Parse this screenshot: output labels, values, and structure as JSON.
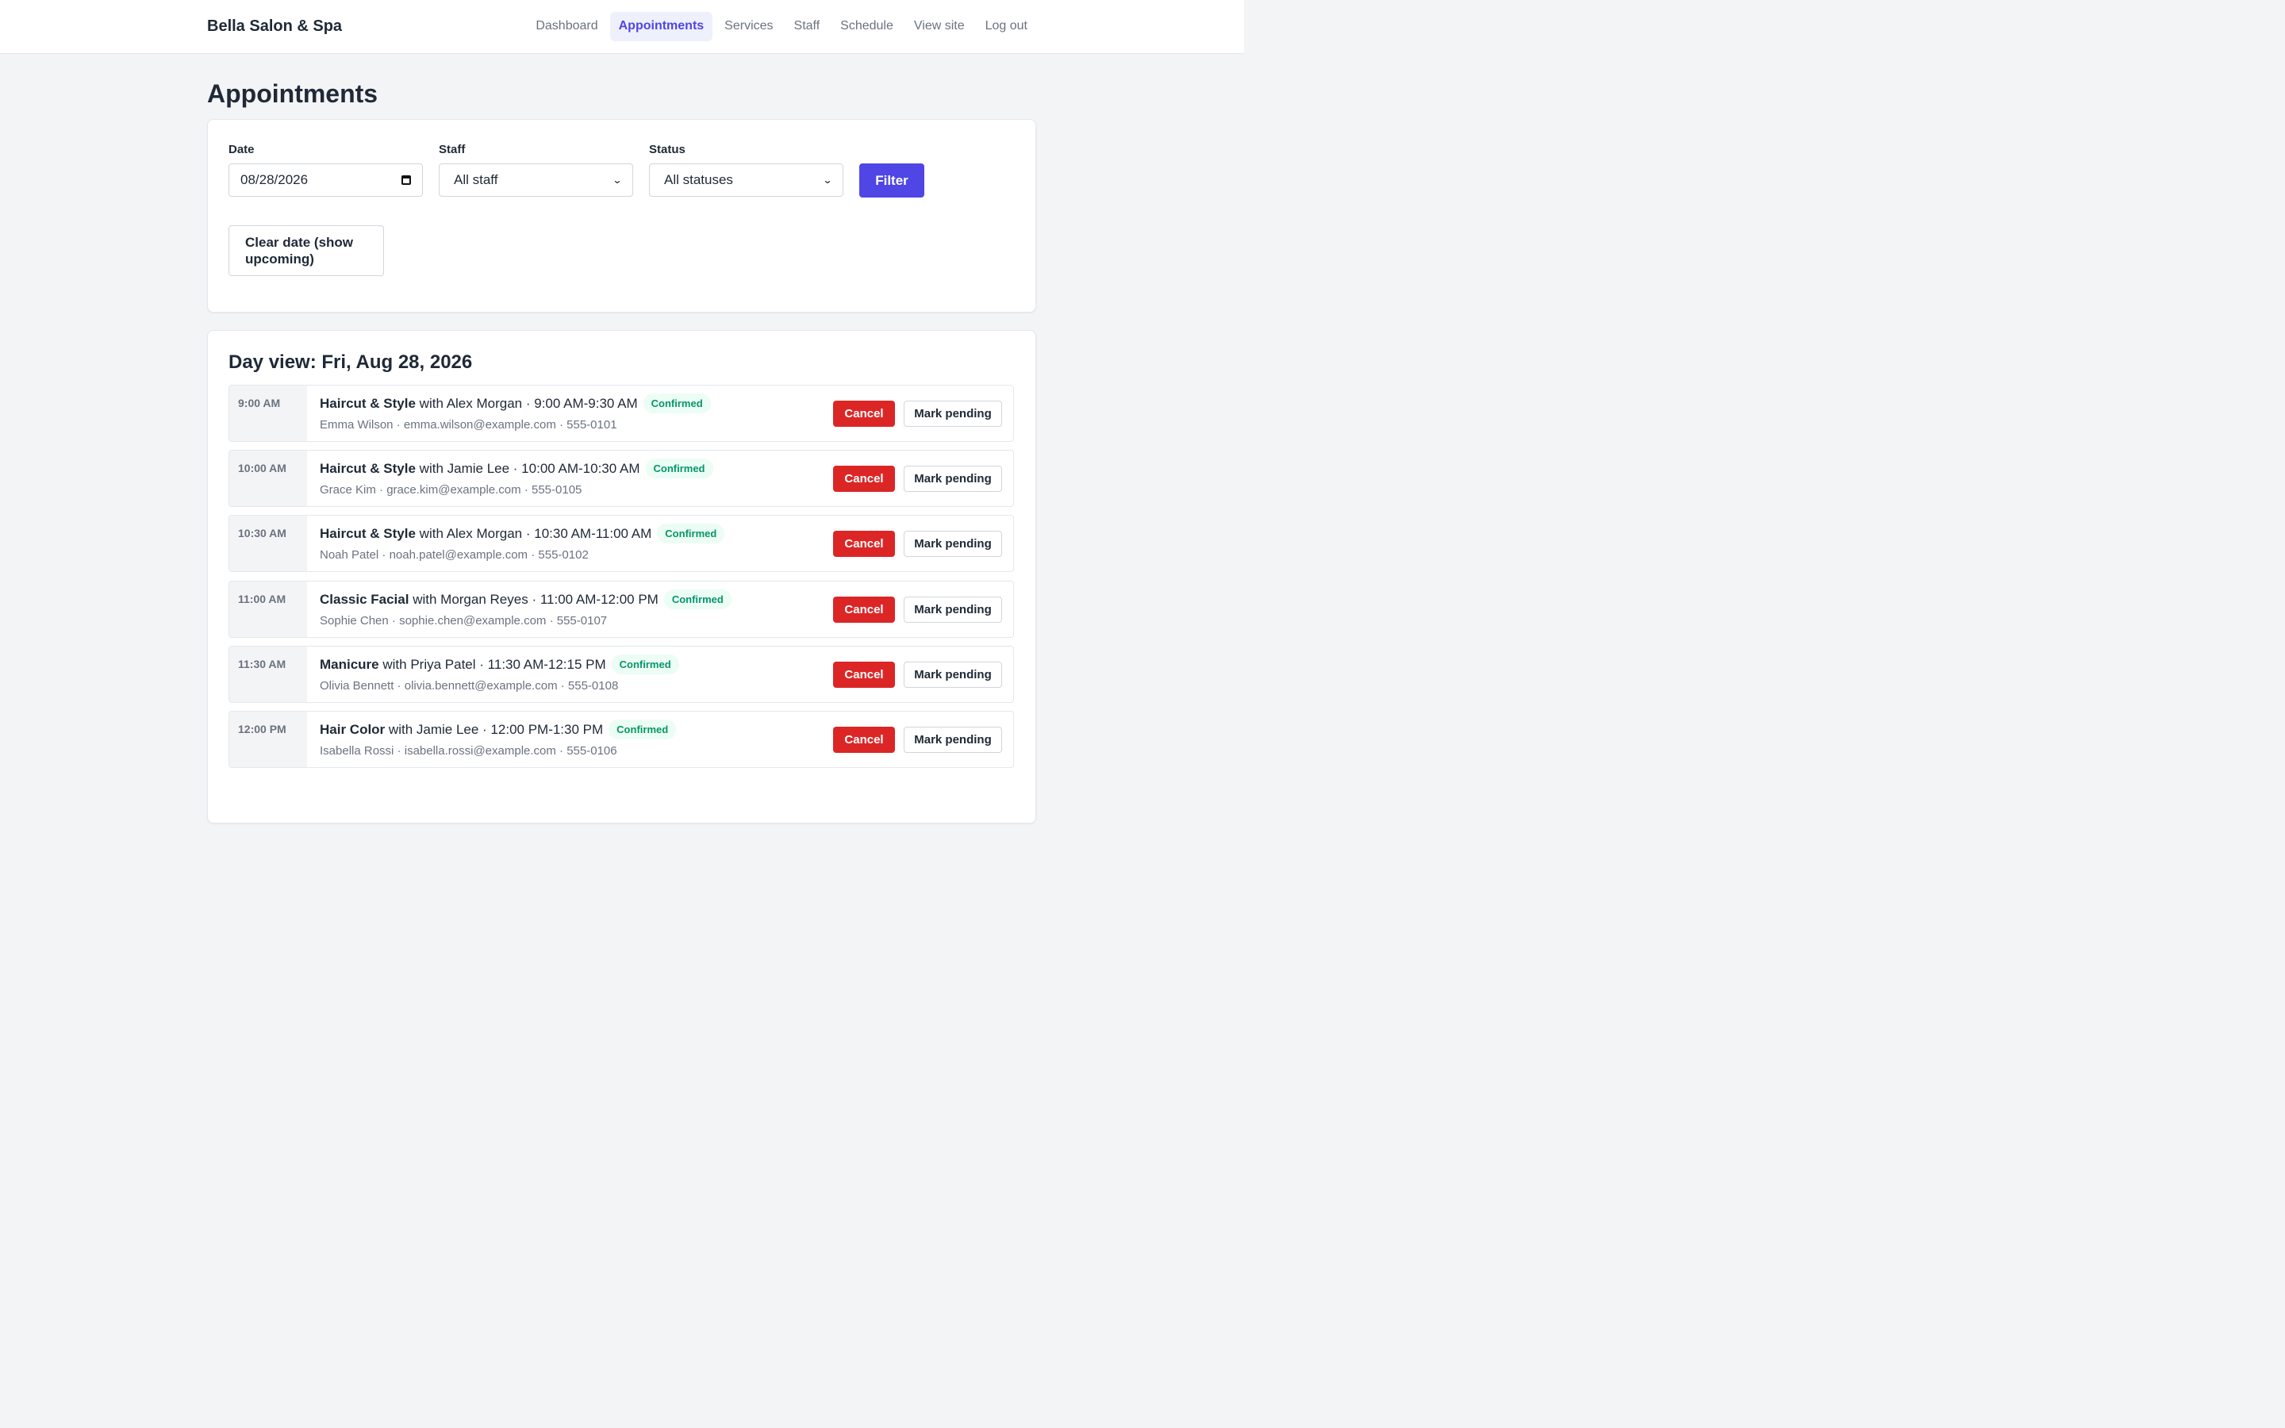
{
  "brand": "Bella Salon & Spa",
  "nav": [
    {
      "label": "Dashboard",
      "active": false
    },
    {
      "label": "Appointments",
      "active": true
    },
    {
      "label": "Services",
      "active": false
    },
    {
      "label": "Staff",
      "active": false
    },
    {
      "label": "Schedule",
      "active": false
    },
    {
      "label": "View site",
      "active": false
    },
    {
      "label": "Log out",
      "active": false
    }
  ],
  "page_title": "Appointments",
  "filters": {
    "date_label": "Date",
    "date_value": "08/28/2026",
    "staff_label": "Staff",
    "staff_value": "All staff",
    "status_label": "Status",
    "status_value": "All statuses",
    "filter_button": "Filter",
    "clear_button": "Clear date (show upcoming)"
  },
  "day_view": {
    "title": "Day view: Fri, Aug 28, 2026",
    "cancel_label": "Cancel",
    "pending_label": "Mark pending",
    "appointments": [
      {
        "time": "9:00 AM",
        "service": "Haircut & Style",
        "with": "with Alex Morgan",
        "range": "· 9:00 AM-9:30 AM",
        "status": "Confirmed",
        "client": "Emma Wilson",
        "email": "emma.wilson@example.com",
        "phone": "555-0101"
      },
      {
        "time": "10:00 AM",
        "service": "Haircut & Style",
        "with": "with Jamie Lee",
        "range": "· 10:00 AM-10:30 AM",
        "status": "Confirmed",
        "client": "Grace Kim",
        "email": "grace.kim@example.com",
        "phone": "555-0105"
      },
      {
        "time": "10:30 AM",
        "service": "Haircut & Style",
        "with": "with Alex Morgan",
        "range": "· 10:30 AM-11:00 AM",
        "status": "Confirmed",
        "client": "Noah Patel",
        "email": "noah.patel@example.com",
        "phone": "555-0102"
      },
      {
        "time": "11:00 AM",
        "service": "Classic Facial",
        "with": "with Morgan Reyes",
        "range": "· 11:00 AM-12:00 PM",
        "status": "Confirmed",
        "client": "Sophie Chen",
        "email": "sophie.chen@example.com",
        "phone": "555-0107"
      },
      {
        "time": "11:30 AM",
        "service": "Manicure",
        "with": "with Priya Patel",
        "range": "· 11:30 AM-12:15 PM",
        "status": "Confirmed",
        "client": "Olivia Bennett",
        "email": "olivia.bennett@example.com",
        "phone": "555-0108"
      },
      {
        "time": "12:00 PM",
        "service": "Hair Color",
        "with": "with Jamie Lee",
        "range": "· 12:00 PM-1:30 PM",
        "status": "Confirmed",
        "client": "Isabella Rossi",
        "email": "isabella.rossi@example.com",
        "phone": "555-0106"
      }
    ]
  }
}
